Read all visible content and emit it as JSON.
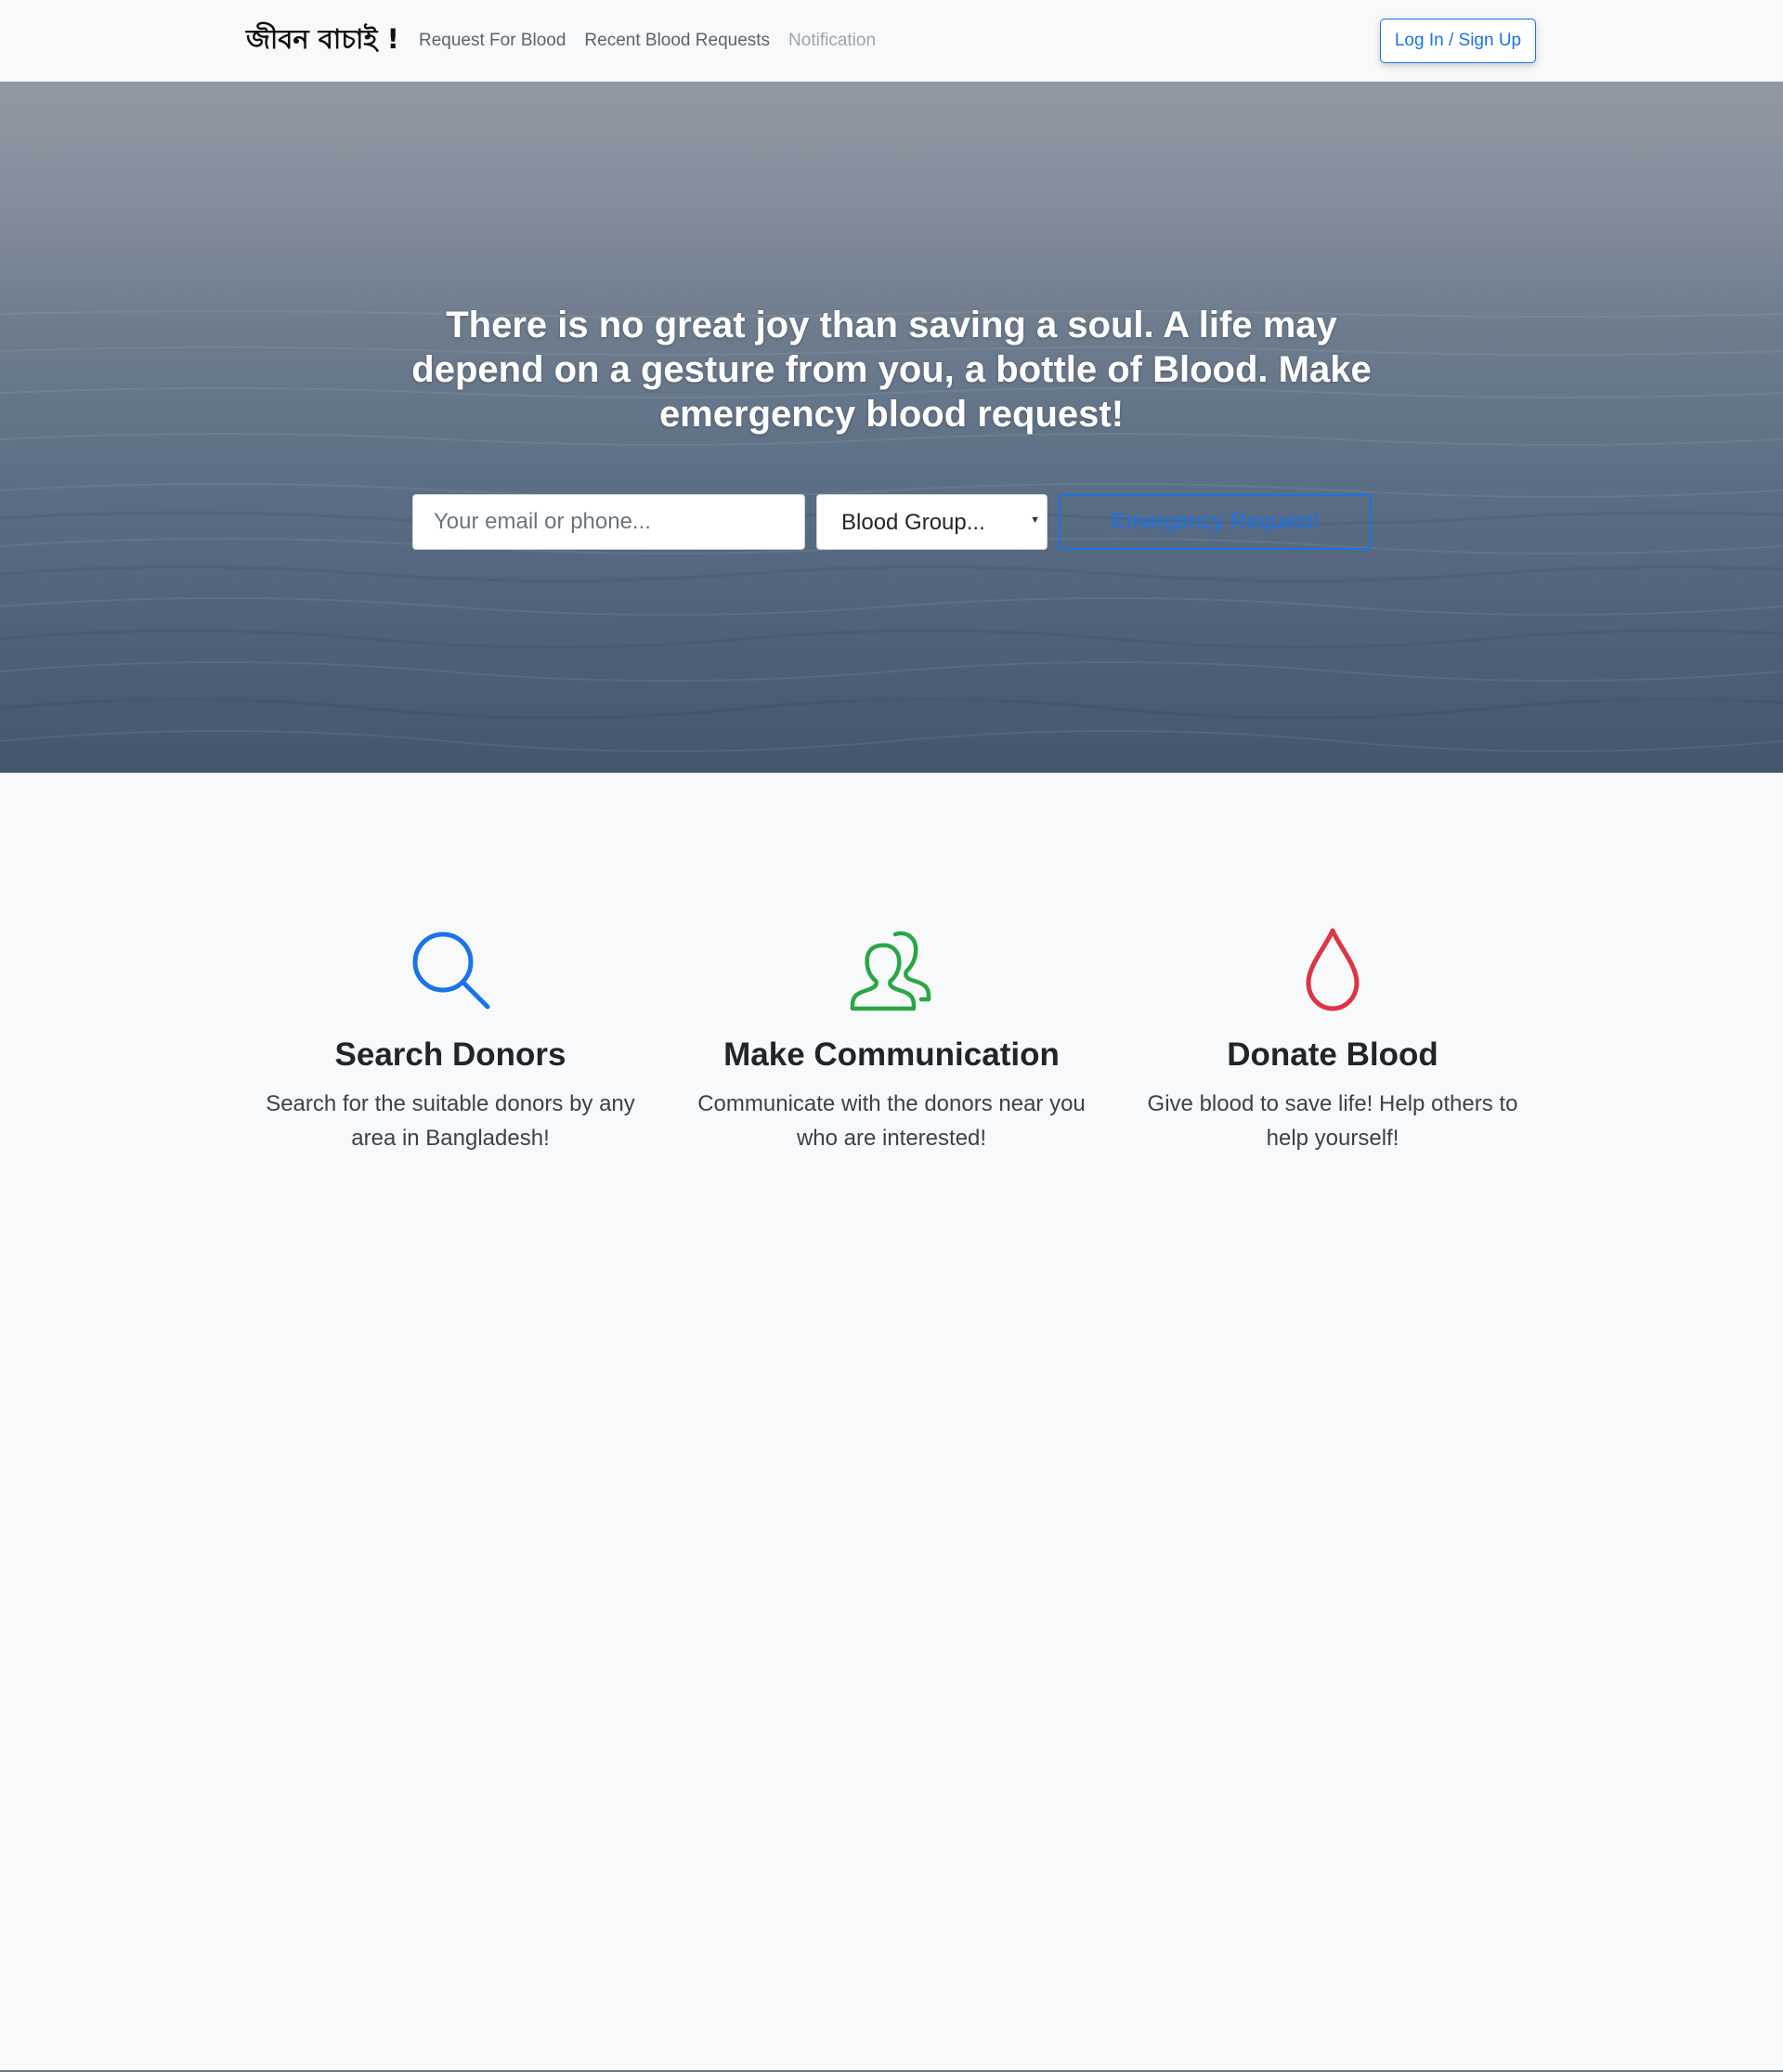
{
  "navbar": {
    "brand": "জীবন বাচাই !",
    "links": [
      {
        "label": "Request For Blood"
      },
      {
        "label": "Recent Blood Requests"
      },
      {
        "label": "Notification"
      }
    ],
    "login_label": "Log In / Sign Up"
  },
  "hero": {
    "heading": "There is no great joy than saving a soul. A life may depend on a gesture from you, a bottle of Blood. Make emergency blood request!",
    "contact_placeholder": "Your email or phone...",
    "blood_group_selected": "Blood Group...",
    "emergency_label": "Emergency Request!"
  },
  "features": [
    {
      "icon": "search-icon",
      "title": "Search Donors",
      "text": "Search for the suitable donors by any area in Bangladesh!",
      "color": "#1a73e8"
    },
    {
      "icon": "users-icon",
      "title": "Make Communication",
      "text": "Communicate with the donors near you who are interested!",
      "color": "#28a745"
    },
    {
      "icon": "blood-drop-icon",
      "title": "Donate Blood",
      "text": "Give blood to save life! Help others to help yourself!",
      "color": "#dc3545"
    }
  ],
  "colors": {
    "primary": "#1a73e8",
    "success": "#28a745",
    "danger": "#dc3545",
    "background": "#f8f9fa"
  }
}
